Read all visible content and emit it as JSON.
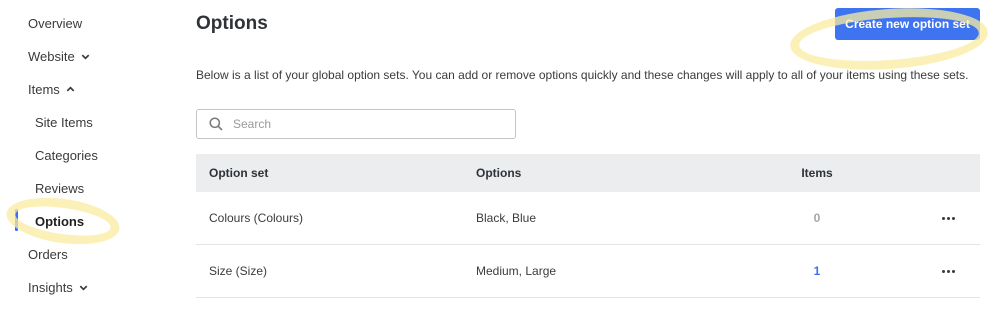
{
  "sidebar": {
    "items": [
      {
        "label": "Overview"
      },
      {
        "label": "Website"
      },
      {
        "label": "Items"
      },
      {
        "label": "Site Items"
      },
      {
        "label": "Categories"
      },
      {
        "label": "Reviews"
      },
      {
        "label": "Options",
        "active": true
      },
      {
        "label": "Orders"
      },
      {
        "label": "Insights"
      }
    ]
  },
  "header": {
    "title": "Options",
    "create_button_label": "Create new option set"
  },
  "description": "Below is a list of your global option sets. You can add or remove options quickly and these changes will apply to all of your items using these sets.",
  "search": {
    "placeholder": "Search",
    "value": ""
  },
  "table": {
    "columns": [
      "Option set",
      "Options",
      "Items"
    ],
    "rows": [
      {
        "option_set": "Colours (Colours)",
        "options": "Black, Blue",
        "items": "0"
      },
      {
        "option_set": "Size (Size)",
        "options": "Medium, Large",
        "items": "1"
      }
    ]
  },
  "colors": {
    "accent": "#3f74f0",
    "highlight": "#faeca0",
    "header_bg": "#ebedef"
  }
}
